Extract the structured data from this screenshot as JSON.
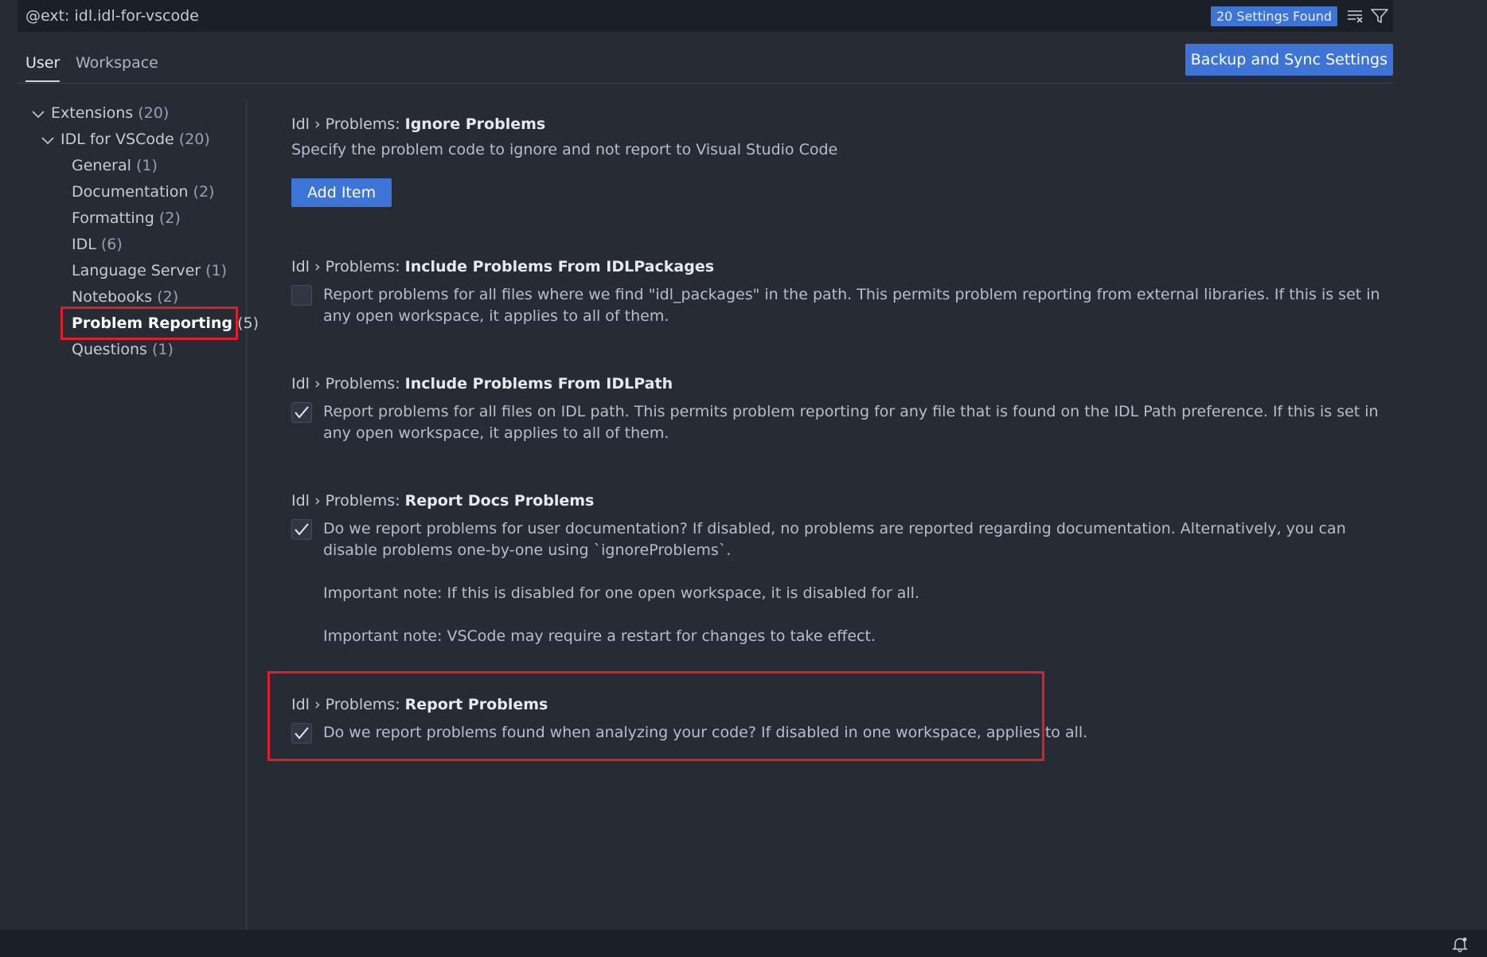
{
  "search": {
    "value": "@ext: idl.idl-for-vscode",
    "results_badge": "20 Settings Found"
  },
  "tabs": [
    {
      "label": "User",
      "active": true
    },
    {
      "label": "Workspace",
      "active": false
    }
  ],
  "sync_button": "Backup and Sync Settings",
  "toc": {
    "extensions": {
      "label": "Extensions",
      "count": "(20)"
    },
    "idl_for_vscode": {
      "label": "IDL for VSCode",
      "count": "(20)"
    },
    "items": [
      {
        "label": "General",
        "count": "(1)"
      },
      {
        "label": "Documentation",
        "count": "(2)"
      },
      {
        "label": "Formatting",
        "count": "(2)"
      },
      {
        "label": "IDL",
        "count": "(6)"
      },
      {
        "label": "Language Server",
        "count": "(1)"
      },
      {
        "label": "Notebooks",
        "count": "(2)"
      },
      {
        "label": "Problem Reporting",
        "count": "(5)",
        "selected": true
      },
      {
        "label": "Questions",
        "count": "(1)"
      }
    ]
  },
  "settings": [
    {
      "prefix": "Idl › Problems: ",
      "name": "Ignore Problems",
      "description": "Specify the problem code to ignore and not report to Visual Studio Code",
      "button": "Add Item"
    },
    {
      "prefix": "Idl › Problems: ",
      "name": "Include Problems From IDLPackages",
      "checked": false,
      "description": "Report problems for all files where we find \"idl_packages\" in the path. This permits problem reporting from external libraries. If this is set in any open workspace, it applies to all of them."
    },
    {
      "prefix": "Idl › Problems: ",
      "name": "Include Problems From IDLPath",
      "checked": true,
      "description": "Report problems for all files on IDL path. This permits problem reporting for any file that is found on the IDL Path preference. If this is set in any open workspace, it applies to all of them."
    },
    {
      "prefix": "Idl › Problems: ",
      "name": "Report Docs Problems",
      "checked": true,
      "description": "Do we report problems for user documentation? If disabled, no problems are reported regarding documentation. Alternatively, you can disable problems one-by-one using `ignoreProblems`.",
      "note1": "Important note: If this is disabled for one open workspace, it is disabled for all.",
      "note2": "Important note: VSCode may require a restart for changes to take effect."
    },
    {
      "prefix": "Idl › Problems: ",
      "name": "Report Problems",
      "checked": true,
      "description": "Do we report problems found when analyzing your code? If disabled in one workspace, applies to all."
    }
  ],
  "colors": {
    "background": "#262b34",
    "accent": "#3e74d6",
    "highlight": "#e11d2b"
  }
}
